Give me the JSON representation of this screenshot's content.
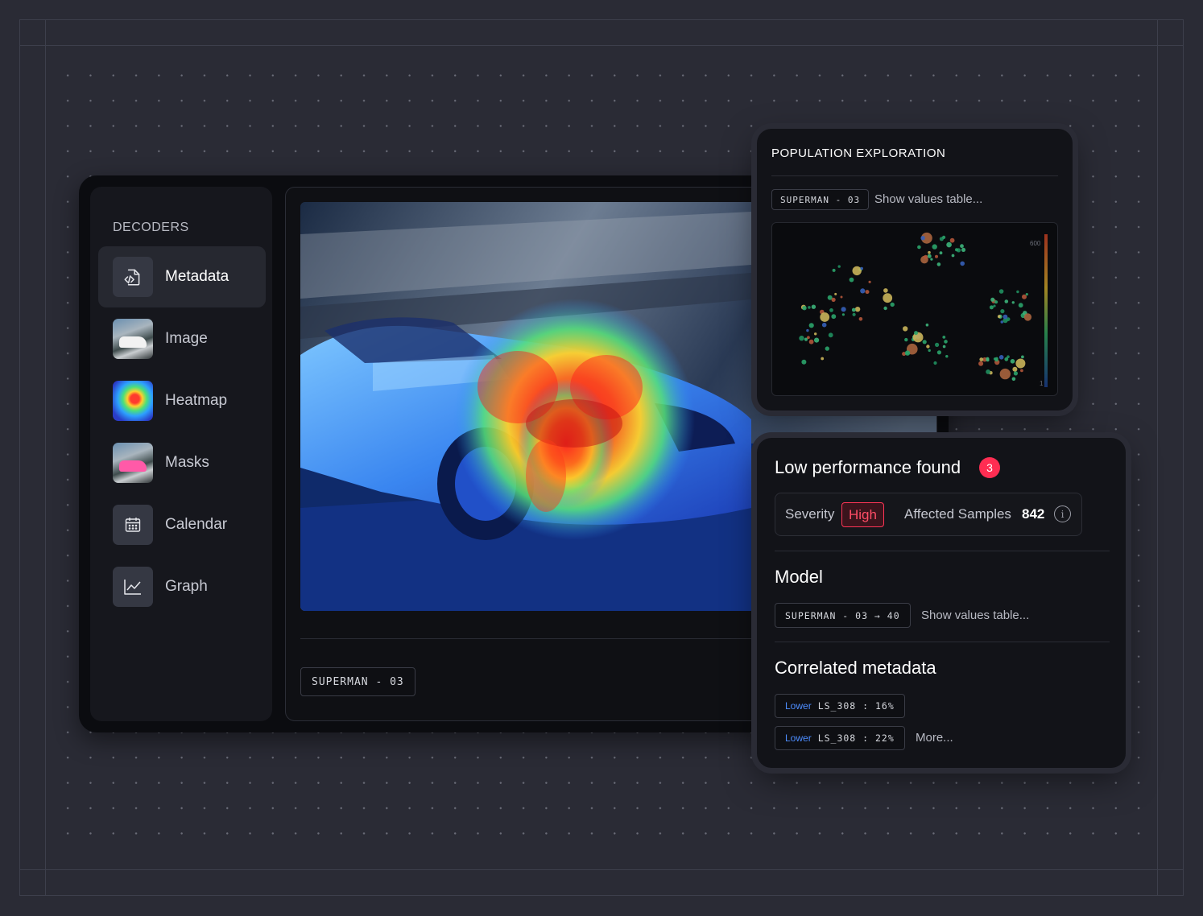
{
  "sidebar": {
    "title": "DECODERS",
    "items": [
      {
        "label": "Metadata",
        "icon": "code-file-icon",
        "active": true
      },
      {
        "label": "Image",
        "icon": "image-thumbnail"
      },
      {
        "label": "Heatmap",
        "icon": "heatmap-thumbnail"
      },
      {
        "label": "Masks",
        "icon": "mask-thumbnail"
      },
      {
        "label": "Calendar",
        "icon": "calendar-icon"
      },
      {
        "label": "Graph",
        "icon": "graph-icon"
      }
    ]
  },
  "viewer": {
    "tag": "SUPERMAN - 03"
  },
  "population": {
    "title": "POPULATION EXPLORATION",
    "tag": "SUPERMAN - 03",
    "show_values": "Show values table...",
    "colorbar_max": "600",
    "colorbar_min": "1"
  },
  "performance": {
    "title": "Low performance found",
    "count": "3",
    "severity_label": "Severity",
    "severity_value": "High",
    "affected_label": "Affected Samples",
    "affected_value": "842",
    "model_title": "Model",
    "model_tag": "SUPERMAN - 03 → 40",
    "model_show_values": "Show values table...",
    "correlated_title": "Correlated metadata",
    "correlated": [
      {
        "direction": "Lower",
        "text": "LS_308 : 16%"
      },
      {
        "direction": "Lower",
        "text": "LS_308 : 22%"
      }
    ],
    "more": "More..."
  },
  "colors": {
    "background": "#2a2b35",
    "panel": "#121318",
    "accent_red": "#ff2d52",
    "accent_blue": "#4d8dff"
  }
}
